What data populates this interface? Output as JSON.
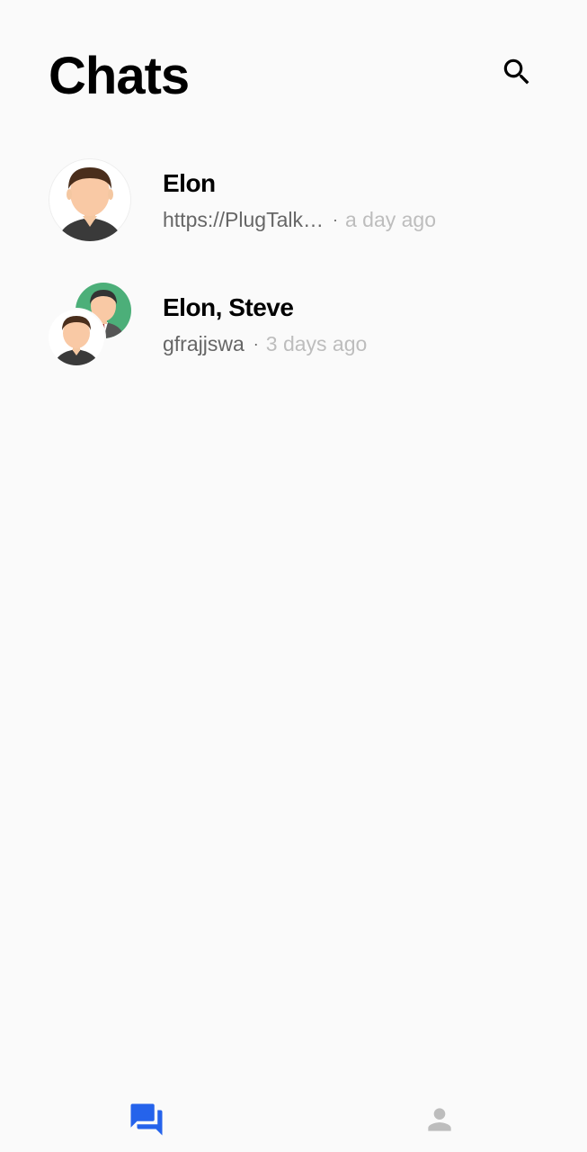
{
  "header": {
    "title": "Chats",
    "search_icon": "search-icon"
  },
  "chats": [
    {
      "name": "Elon",
      "preview": "https://PlugTalk…",
      "separator": "·",
      "time": "a day ago",
      "avatar": "single-person-avatar"
    },
    {
      "name": "Elon, Steve",
      "preview": "gfrajjswa",
      "separator": "·",
      "time": "3 days ago",
      "avatar": "group-avatar"
    }
  ],
  "bottom_nav": {
    "items": [
      {
        "icon": "chats-icon",
        "active": true
      },
      {
        "icon": "profile-icon",
        "active": false
      }
    ]
  },
  "colors": {
    "background": "#fafafa",
    "accent": "#2563eb",
    "inactive_icon": "#bdbdbd",
    "preview_text": "#666666",
    "time_text": "#bdbdbd",
    "avatar_green": "#4caf79"
  }
}
